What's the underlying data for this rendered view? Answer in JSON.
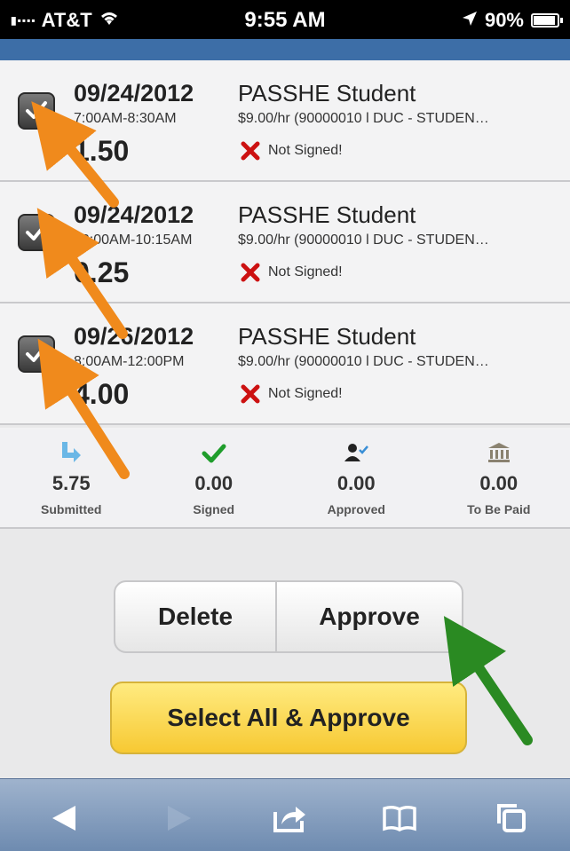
{
  "status_bar": {
    "carrier": "AT&T",
    "time": "9:55 AM",
    "battery": "90%"
  },
  "entries": [
    {
      "date": "09/24/2012",
      "time_range": "7:00AM-8:30AM",
      "hours": "1.50",
      "job": "PASSHE Student",
      "rate": "$9.00/hr (90000010 l DUC - STUDEN…",
      "sign_status": "Not Signed!",
      "checked": true
    },
    {
      "date": "09/24/2012",
      "time_range": "10:00AM-10:15AM",
      "hours": "0.25",
      "job": "PASSHE Student",
      "rate": "$9.00/hr (90000010 l DUC - STUDEN…",
      "sign_status": "Not Signed!",
      "checked": true
    },
    {
      "date": "09/26/2012",
      "time_range": "8:00AM-12:00PM",
      "hours": "4.00",
      "job": "PASSHE Student",
      "rate": "$9.00/hr (90000010 l DUC - STUDEN…",
      "sign_status": "Not Signed!",
      "checked": true
    }
  ],
  "summary": [
    {
      "value": "5.75",
      "label": "Submitted",
      "icon": "submitted-arrow-icon"
    },
    {
      "value": "0.00",
      "label": "Signed",
      "icon": "checkmark-icon"
    },
    {
      "value": "0.00",
      "label": "Approved",
      "icon": "approver-icon"
    },
    {
      "value": "0.00",
      "label": "To Be Paid",
      "icon": "bank-icon"
    }
  ],
  "buttons": {
    "delete": "Delete",
    "approve": "Approve",
    "select_all": "Select All & Approve"
  },
  "colors": {
    "checkbox_annotation_arrow": "#f08a1c",
    "approve_annotation_arrow": "#2a8a22",
    "not_signed_x": "#cc1111",
    "signed_check": "#1f9d2b",
    "select_all_button": "#f7c933",
    "toolbar": "#7f99bb"
  }
}
